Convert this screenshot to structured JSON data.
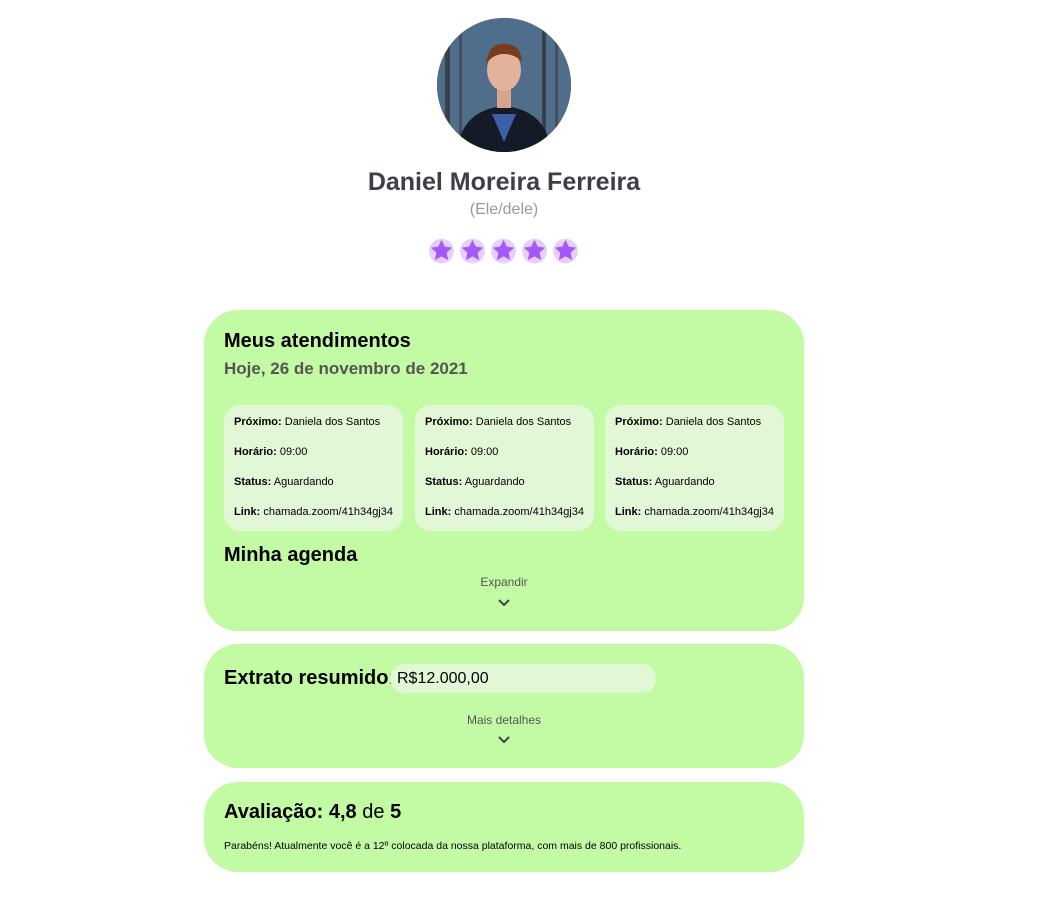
{
  "profile": {
    "name": "Daniel Moreira Ferreira",
    "pronoun": "(Ele/dele)",
    "rating_stars": 5,
    "star_color": "#a259f7"
  },
  "atendimentos": {
    "title": "Meus atendimentos",
    "date": "Hoje, 26 de novembro de 2021",
    "labels": {
      "proximo": "Próximo:",
      "horario": "Horário:",
      "status": "Status:",
      "link": "Link:"
    },
    "slots": [
      {
        "proximo": "Daniela dos Santos",
        "horario": "09:00",
        "status": "Aguardando",
        "link": "chamada.zoom/41h34gj34"
      },
      {
        "proximo": "Daniela dos Santos",
        "horario": "09:00",
        "status": "Aguardando",
        "link": "chamada.zoom/41h34gj34"
      },
      {
        "proximo": "Daniela dos Santos",
        "horario": "09:00",
        "status": "Aguardando",
        "link": "chamada.zoom/41h34gj34"
      }
    ],
    "agenda_title": "Minha agenda",
    "expand_label": "Expandir"
  },
  "extrato": {
    "label": "Extrato resumido:",
    "value": "R$12.000,00",
    "details_label": "Mais detalhes"
  },
  "avaliacao": {
    "prefix": "Avaliação:",
    "score": "4,8",
    "connector": "de",
    "max": "5",
    "message": "Parabéns! Atualmente você é a 12º colocada da nossa plataforma, com mais de 800 profissionais."
  },
  "colors": {
    "card_bg": "#c3fba5",
    "inner_bg": "#e1f7d6"
  }
}
